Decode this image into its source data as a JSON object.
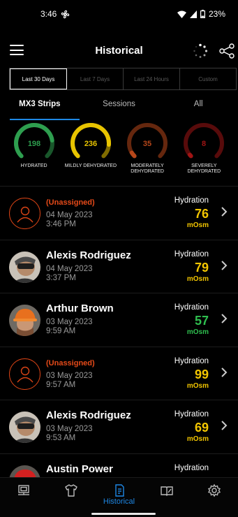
{
  "status": {
    "time": "3:46",
    "battery": "23%"
  },
  "header": {
    "title": "Historical"
  },
  "ranges": [
    "Last 30 Days",
    "Last 7 Days",
    "Last 24 Hours",
    "Custom"
  ],
  "tabs": [
    "MX3 Strips",
    "Sessions",
    "All"
  ],
  "gauges": [
    {
      "value": "198",
      "label": "HYDRATED",
      "color": "#2e9e4f",
      "fill": 0.8
    },
    {
      "value": "236",
      "label": "MILDLY DEHYDRATED",
      "color": "#e8c400",
      "fill": 0.85
    },
    {
      "value": "35",
      "label": "MODERATELY DEHYDRATED",
      "color": "#b7471a",
      "fill": 0.05
    },
    {
      "value": "8",
      "label": "SEVERELY DEHYDRATED",
      "color": "#a01414",
      "fill": 0.02
    }
  ],
  "hydration_label": "Hydration",
  "unit": "mOsm",
  "entries": [
    {
      "name": "(Unassigned)",
      "unassigned": true,
      "date": "04 May 2023",
      "time": "3:46 PM",
      "value": "76",
      "color": "#f2c500"
    },
    {
      "name": "Alexis Rodriguez",
      "unassigned": false,
      "avatar": "worker-goggles",
      "date": "04 May 2023",
      "time": "3:37 PM",
      "value": "79",
      "color": "#f2c500"
    },
    {
      "name": "Arthur Brown",
      "unassigned": false,
      "avatar": "worker-hardhat",
      "date": "03 May 2023",
      "time": "9:59 AM",
      "value": "57",
      "color": "#2fbf4f"
    },
    {
      "name": "(Unassigned)",
      "unassigned": true,
      "date": "03 May 2023",
      "time": "9:57 AM",
      "value": "99",
      "color": "#f2c500"
    },
    {
      "name": "Alexis Rodriguez",
      "unassigned": false,
      "avatar": "worker-goggles",
      "date": "03 May 2023",
      "time": "9:53 AM",
      "value": "69",
      "color": "#f2c500"
    },
    {
      "name": "Austin Power",
      "unassigned": false,
      "avatar": "worker-red-hardhat",
      "date": "",
      "time": "",
      "value": "",
      "color": "#f2c500"
    }
  ],
  "nav": [
    {
      "icon": "monitor-icon",
      "label": ""
    },
    {
      "icon": "shirt-icon",
      "label": ""
    },
    {
      "icon": "historical-icon",
      "label": "Historical",
      "active": true
    },
    {
      "icon": "book-icon",
      "label": ""
    },
    {
      "icon": "settings-icon",
      "label": ""
    }
  ]
}
